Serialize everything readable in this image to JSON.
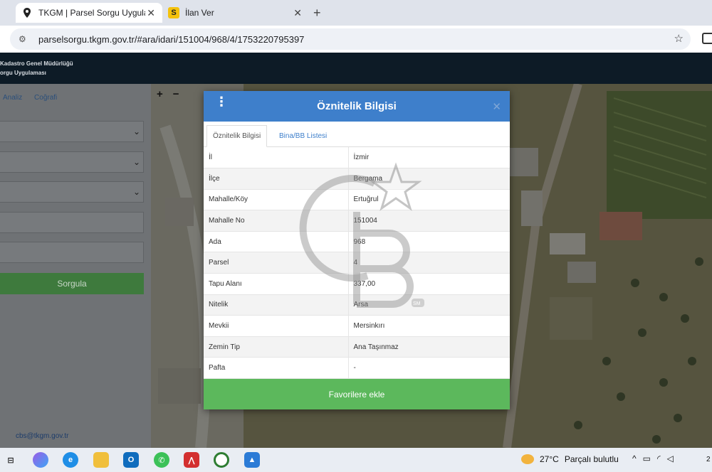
{
  "browser": {
    "tabs": [
      {
        "title": "TKGM | Parsel Sorgu Uygulamas",
        "icon": "map-pin-icon",
        "active": true
      },
      {
        "title": "İlan Ver",
        "icon": "s-logo-icon",
        "active": false
      }
    ],
    "url": "parselsorgu.tkgm.gov.tr/#ara/idari/151004/968/4/1753220795397"
  },
  "header": {
    "line1": "Kadastro Genel Müdürlüğü",
    "line2": "orgu Uygulaması"
  },
  "sidebar": {
    "links": [
      "Analiz",
      "Coğrafi"
    ],
    "search_button": "Sorgula",
    "email": "cbs@tkgm.gov.tr"
  },
  "map": {
    "controls": [
      "+",
      "−"
    ]
  },
  "modal": {
    "title": "Öznitelik Bilgisi",
    "tabs": [
      "Öznitelik Bilgisi",
      "Bina/BB Listesi"
    ],
    "rows": [
      {
        "key": "İl",
        "value": "İzmir"
      },
      {
        "key": "İlçe",
        "value": "Bergama"
      },
      {
        "key": "Mahalle/Köy",
        "value": "Ertuğrul"
      },
      {
        "key": "Mahalle No",
        "value": "151004"
      },
      {
        "key": "Ada",
        "value": "968"
      },
      {
        "key": "Parsel",
        "value": "4"
      },
      {
        "key": "Tapu Alanı",
        "value": "337,00"
      },
      {
        "key": "Nitelik",
        "value": "Arsa"
      },
      {
        "key": "Mevkii",
        "value": "Mersinkırı"
      },
      {
        "key": "Zemin Tip",
        "value": "Ana Taşınmaz"
      },
      {
        "key": "Pafta",
        "value": "-"
      }
    ],
    "favorite_button": "Favorilere ekle",
    "watermark_text": "SM"
  },
  "taskbar": {
    "weather_temp": "27°C",
    "weather_desc": "Parçalı bulutlu",
    "clock": "2"
  },
  "colors": {
    "modal_header": "#3e7fcb",
    "favorite_button": "#5cb85c",
    "app_header": "#0d1b26"
  }
}
